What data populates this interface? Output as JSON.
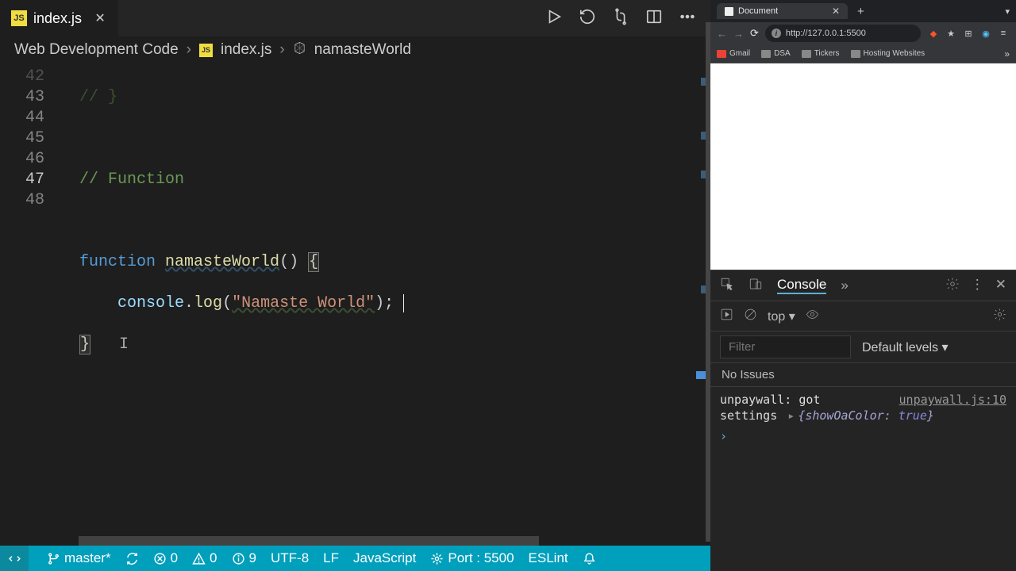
{
  "vscode": {
    "tab": {
      "file": "index.js",
      "lang_badge": "JS"
    },
    "breadcrumb": {
      "project": "Web Development Code",
      "file": "index.js",
      "symbol": "namasteWorld"
    },
    "gutter_lines": [
      "42",
      "43",
      "44",
      "45",
      "46",
      "47",
      "48"
    ],
    "code": {
      "line42": "// }",
      "line44_comment": "// Function",
      "kw_function": "function",
      "func_name": "namasteWorld",
      "parens": "()",
      "brace_open": "{",
      "console_obj": "console",
      "dot": ".",
      "log_method": "log",
      "call_open": "(",
      "string_literal": "\"Namaste World\"",
      "call_close_semicolon": ");",
      "brace_close": "}"
    },
    "status": {
      "branch": "master*",
      "errors": "0",
      "warnings": "0",
      "info": "9",
      "encoding": "UTF-8",
      "eol": "LF",
      "language": "JavaScript",
      "port": "Port : 5500",
      "linter": "ESLint"
    }
  },
  "browser": {
    "tab_title": "Document",
    "url": "http://127.0.0.1:5500",
    "bookmarks": {
      "gmail": "Gmail",
      "dsa": "DSA",
      "tickers": "Tickers",
      "hosting": "Hosting Websites"
    }
  },
  "devtools": {
    "tab_console": "Console",
    "top_select": "top ▾",
    "filter_placeholder": "Filter",
    "default_levels": "Default levels ▾",
    "no_issues": "No Issues",
    "log1_msg": "unpaywall: got settings",
    "log1_src": "unpaywall.js:10",
    "obj_open": "{",
    "obj_key": "showOaColor:",
    "obj_val": "true",
    "obj_close": "}",
    "prompt": "›"
  }
}
